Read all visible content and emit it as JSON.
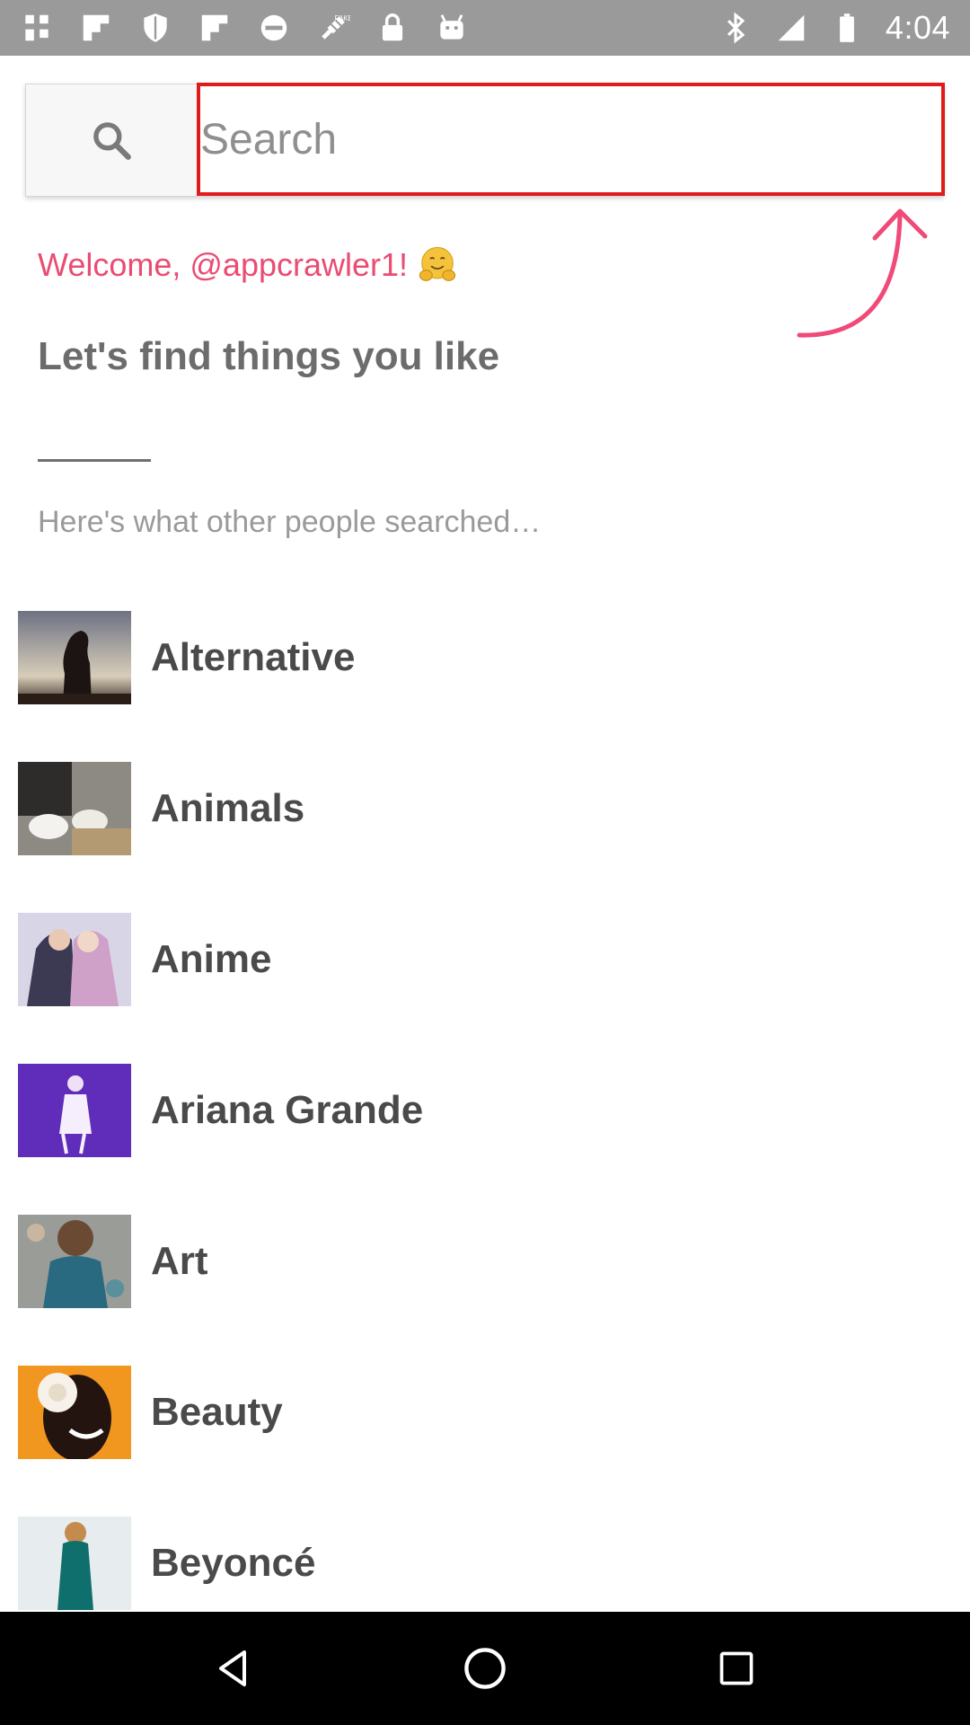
{
  "status_bar": {
    "time": "4:04",
    "icons": [
      "slack-icon",
      "flipboard-icon",
      "shield-icon",
      "flipboard-icon",
      "do-not-disturb-icon",
      "fake-gps-icon",
      "lock-icon",
      "android-icon",
      "bluetooth-icon",
      "signal-icon",
      "battery-icon"
    ],
    "fake_gps_label": "FAKE"
  },
  "search": {
    "placeholder": "Search",
    "icon": "search-icon",
    "highlight_color": "#e11b1b"
  },
  "intro": {
    "welcome": "Welcome, @appcrawler1!",
    "welcome_emoji": "hugging-face-emoji",
    "headline": "Let's find things you like",
    "subtext": "Here's what other people searched…",
    "accent_color": "#ea4c72"
  },
  "topics": [
    {
      "label": "Alternative",
      "image": "silhouette-sunset-thumbnail"
    },
    {
      "label": "Animals",
      "image": "rabbits-thumbnail"
    },
    {
      "label": "Anime",
      "image": "anime-couple-thumbnail"
    },
    {
      "label": "Ariana Grande",
      "image": "concert-stage-thumbnail"
    },
    {
      "label": "Art",
      "image": "painting-woman-thumbnail"
    },
    {
      "label": "Beauty",
      "image": "woman-with-flower-thumbnail"
    },
    {
      "label": "Beyoncé",
      "image": "woman-teal-dress-thumbnail"
    }
  ],
  "nav_bar": {
    "back": "back-triangle-icon",
    "home": "home-circle-icon",
    "recents": "recents-square-icon"
  }
}
